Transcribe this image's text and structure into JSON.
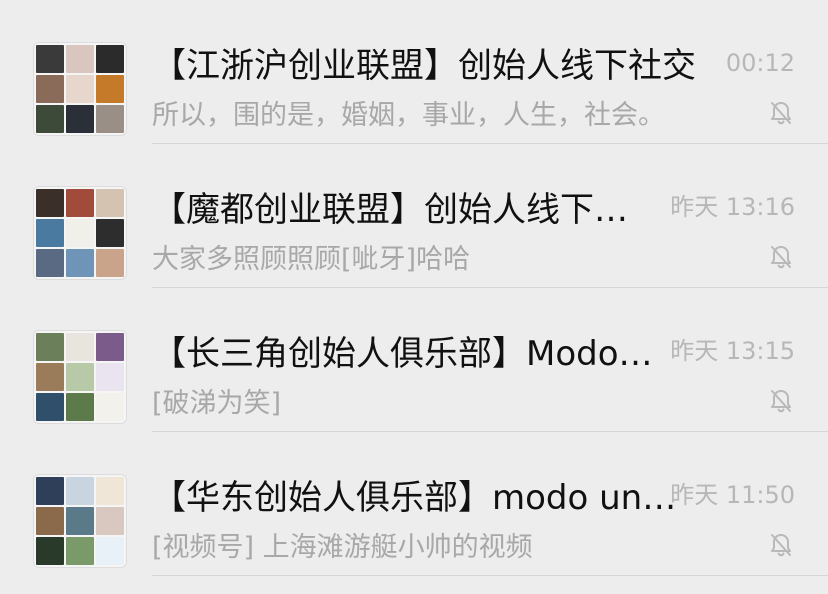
{
  "chats": [
    {
      "title": "【江浙沪创业联盟】创始人线下社交",
      "preview": "所以，围的是，婚姻，事业，人生，社会。",
      "time": "00:12",
      "muted": true,
      "avatar_colors": [
        "#3a3a3a",
        "#d9c7bf",
        "#2b2b2b",
        "#8a6a58",
        "#e7d6cc",
        "#c57a2a",
        "#3d4a3a",
        "#2a2f38",
        "#9a8f86"
      ]
    },
    {
      "title": "【魔都创业联盟】创始人线下…",
      "preview": "大家多照顾照顾[呲牙]哈哈",
      "time": "昨天 13:16",
      "muted": true,
      "avatar_colors": [
        "#3b2f2a",
        "#a24b3a",
        "#d4c3b0",
        "#4a7aa0",
        "#f1efe9",
        "#2d2d2d",
        "#5a6a82",
        "#6e94b8",
        "#c9a48a"
      ]
    },
    {
      "title": "【长三角创始人俱乐部】Modo…",
      "preview": "[破涕为笑]",
      "time": "昨天 13:15",
      "muted": true,
      "avatar_colors": [
        "#6b7f5a",
        "#e8e4de",
        "#7a5b8a",
        "#9a7c5a",
        "#b8c9a8",
        "#e9e4f0",
        "#2f4f6a",
        "#5c7a4a",
        "#f3f1ec"
      ]
    },
    {
      "title": "【华东创始人俱乐部】modo un…",
      "preview": "[视频号] 上海滩游艇小帅的视频",
      "time": "昨天 11:50",
      "muted": true,
      "avatar_colors": [
        "#2f3f5a",
        "#c8d4e0",
        "#f0e6d8",
        "#8a6a4a",
        "#5a7a8a",
        "#d8c8c0",
        "#2a3a2a",
        "#7a9a6a",
        "#e8f0f8"
      ]
    }
  ]
}
